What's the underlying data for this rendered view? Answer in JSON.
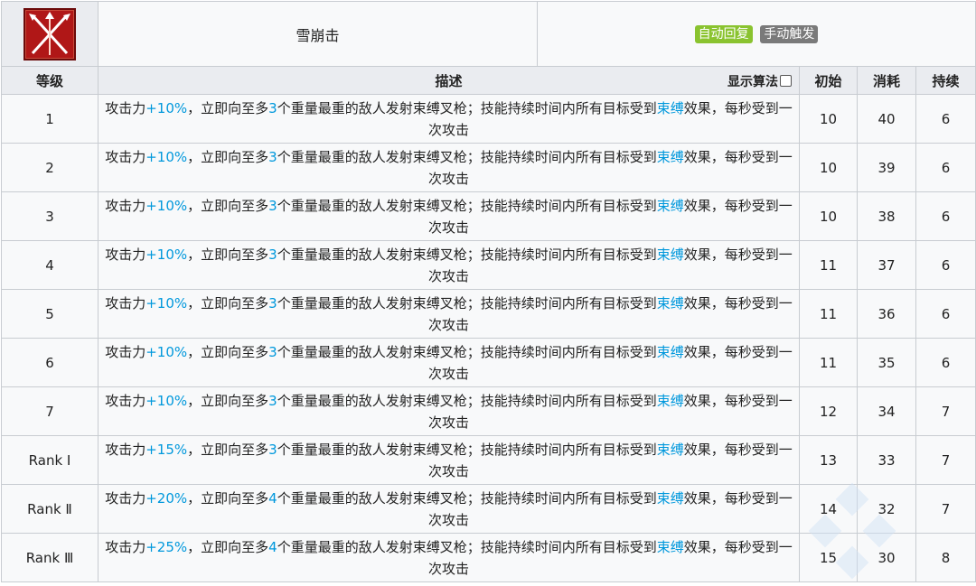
{
  "skill": {
    "name": "雪崩击",
    "tags": {
      "auto": "自动回复",
      "manual": "手动触发"
    },
    "icon_name": "skill-avalanche-icon"
  },
  "header": {
    "level": "等级",
    "description": "描述",
    "show_algorithm": "显示算法",
    "initial": "初始",
    "cost": "消耗",
    "duration": "持续"
  },
  "rows": [
    {
      "level": "1",
      "atk": "+10%",
      "t1": "攻击力",
      "t2": "，立即向至多",
      "count": "3",
      "t3": "个重量最重的敌人发射束缚叉枪；技能持续时间内所有目标受到",
      "bind": "束缚",
      "t4": "效果，每秒受到一次攻击",
      "initial": "10",
      "cost": "40",
      "duration": "6"
    },
    {
      "level": "2",
      "atk": "+10%",
      "t1": "攻击力",
      "t2": "，立即向至多",
      "count": "3",
      "t3": "个重量最重的敌人发射束缚叉枪；技能持续时间内所有目标受到",
      "bind": "束缚",
      "t4": "效果，每秒受到一次攻击",
      "initial": "10",
      "cost": "39",
      "duration": "6"
    },
    {
      "level": "3",
      "atk": "+10%",
      "t1": "攻击力",
      "t2": "，立即向至多",
      "count": "3",
      "t3": "个重量最重的敌人发射束缚叉枪；技能持续时间内所有目标受到",
      "bind": "束缚",
      "t4": "效果，每秒受到一次攻击",
      "initial": "10",
      "cost": "38",
      "duration": "6"
    },
    {
      "level": "4",
      "atk": "+10%",
      "t1": "攻击力",
      "t2": "，立即向至多",
      "count": "3",
      "t3": "个重量最重的敌人发射束缚叉枪；技能持续时间内所有目标受到",
      "bind": "束缚",
      "t4": "效果，每秒受到一次攻击",
      "initial": "11",
      "cost": "37",
      "duration": "6"
    },
    {
      "level": "5",
      "atk": "+10%",
      "t1": "攻击力",
      "t2": "，立即向至多",
      "count": "3",
      "t3": "个重量最重的敌人发射束缚叉枪；技能持续时间内所有目标受到",
      "bind": "束缚",
      "t4": "效果，每秒受到一次攻击",
      "initial": "11",
      "cost": "36",
      "duration": "6"
    },
    {
      "level": "6",
      "atk": "+10%",
      "t1": "攻击力",
      "t2": "，立即向至多",
      "count": "3",
      "t3": "个重量最重的敌人发射束缚叉枪；技能持续时间内所有目标受到",
      "bind": "束缚",
      "t4": "效果，每秒受到一次攻击",
      "initial": "11",
      "cost": "35",
      "duration": "6"
    },
    {
      "level": "7",
      "atk": "+10%",
      "t1": "攻击力",
      "t2": "，立即向至多",
      "count": "3",
      "t3": "个重量最重的敌人发射束缚叉枪；技能持续时间内所有目标受到",
      "bind": "束缚",
      "t4": "效果，每秒受到一次攻击",
      "initial": "12",
      "cost": "34",
      "duration": "7"
    },
    {
      "level": "Rank Ⅰ",
      "atk": "+15%",
      "t1": "攻击力",
      "t2": "，立即向至多",
      "count": "3",
      "t3": "个重量最重的敌人发射束缚叉枪；技能持续时间内所有目标受到",
      "bind": "束缚",
      "t4": "效果，每秒受到一次攻击",
      "initial": "13",
      "cost": "33",
      "duration": "7"
    },
    {
      "level": "Rank Ⅱ",
      "atk": "+20%",
      "t1": "攻击力",
      "t2": "，立即向至多",
      "count": "4",
      "t3": "个重量最重的敌人发射束缚叉枪；技能持续时间内所有目标受到",
      "bind": "束缚",
      "t4": "效果，每秒受到一次攻击",
      "initial": "14",
      "cost": "32",
      "duration": "7"
    },
    {
      "level": "Rank Ⅲ",
      "atk": "+25%",
      "t1": "攻击力",
      "t2": "，立即向至多",
      "count": "4",
      "t3": "个重量最重的敌人发射束缚叉枪；技能持续时间内所有目标受到",
      "bind": "束缚",
      "t4": "效果，每秒受到一次攻击",
      "initial": "15",
      "cost": "30",
      "duration": "8"
    }
  ],
  "colors": {
    "accent": "#0098dc",
    "auto_tag": "#8ac32f",
    "manual_tag": "#7a7a7a",
    "icon_bg": "#b01717"
  }
}
